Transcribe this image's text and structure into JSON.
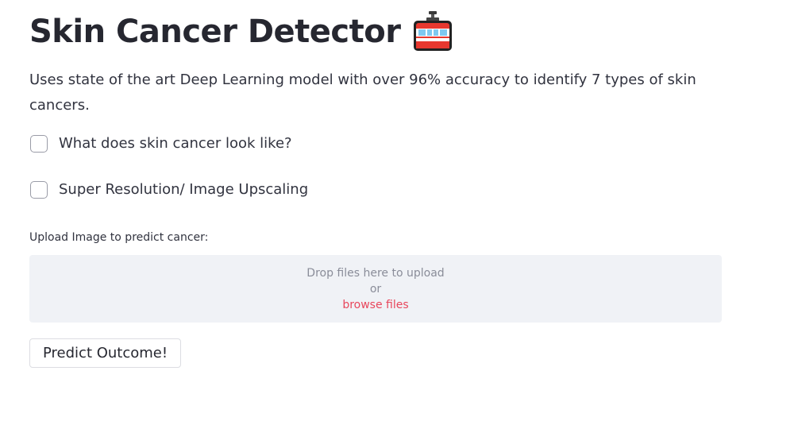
{
  "header": {
    "title": "Skin Cancer Detector",
    "title_icon": "aerial-tramway-icon"
  },
  "description": "Uses state of the art Deep Learning model with over 96% accuracy to identify 7 types of skin cancers.",
  "options": [
    {
      "label": "What does skin cancer look like?",
      "checked": false
    },
    {
      "label": "Super Resolution/ Image Upscaling",
      "checked": false
    }
  ],
  "uploader": {
    "label": "Upload Image to predict cancer:",
    "drop_text": "Drop files here to upload",
    "or_text": "or",
    "browse_text": "browse files"
  },
  "actions": {
    "predict_label": "Predict Outcome!"
  },
  "colors": {
    "text": "#262730",
    "dropzone_bg": "#f0f2f6",
    "link": "#e8475c",
    "muted": "#8a8d99"
  }
}
